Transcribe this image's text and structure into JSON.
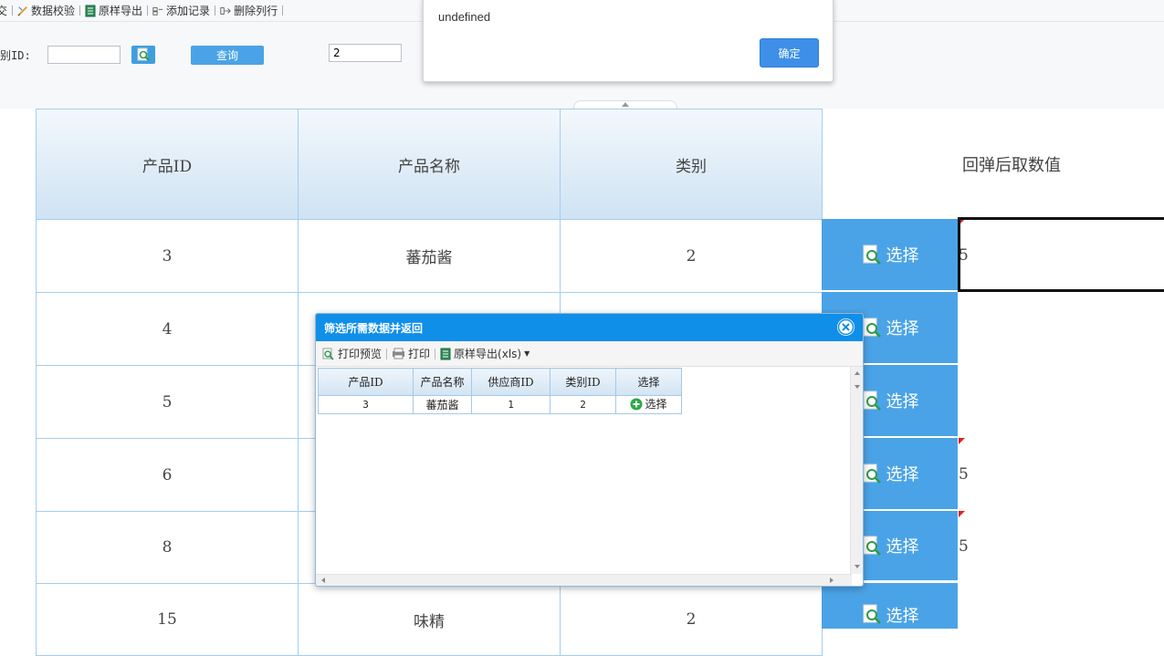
{
  "toolbar": {
    "items": [
      {
        "label": "交",
        "icon": "none"
      },
      {
        "label": "数据校验",
        "icon": "pencil-ruler-icon"
      },
      {
        "label": "原样导出",
        "icon": "spreadsheet-icon"
      },
      {
        "label": "添加记录",
        "icon": "add-record-icon"
      },
      {
        "label": "删除列行",
        "icon": "delete-row-icon"
      }
    ]
  },
  "query": {
    "label": "别ID:",
    "input1_value": "",
    "query_button": "查询",
    "input2_value": "2"
  },
  "alert": {
    "message": "undefined",
    "ok_label": "确定"
  },
  "table": {
    "headers": [
      "产品ID",
      "产品名称",
      "类别",
      "回弹后取数值"
    ],
    "rows": [
      {
        "id": "3",
        "name": "蕃茄酱",
        "category": "2",
        "value": "5"
      },
      {
        "id": "4",
        "name": "",
        "category": "",
        "value": ""
      },
      {
        "id": "5",
        "name": "",
        "category": "",
        "value": ""
      },
      {
        "id": "6",
        "name": "",
        "category": "",
        "value": "5"
      },
      {
        "id": "8",
        "name": "",
        "category": "",
        "value": "5"
      },
      {
        "id": "15",
        "name": "味精",
        "category": "2",
        "value": ""
      }
    ],
    "select_label": "选择"
  },
  "popup": {
    "title": "筛选所需数据并返回",
    "tools": {
      "preview": "打印预览",
      "print": "打印",
      "export": "原样导出(xls)"
    },
    "headers": [
      "产品ID",
      "产品名称",
      "供应商ID",
      "类别ID",
      "选择"
    ],
    "rows": [
      {
        "id": "3",
        "name": "蕃茄酱",
        "supplier": "1",
        "category": "2",
        "pick": "选择"
      }
    ]
  },
  "colors": {
    "accent": "#4aa3e6",
    "popup_title": "#0f8fe8",
    "flag": "#e02020",
    "border": "#a3cdf0"
  }
}
